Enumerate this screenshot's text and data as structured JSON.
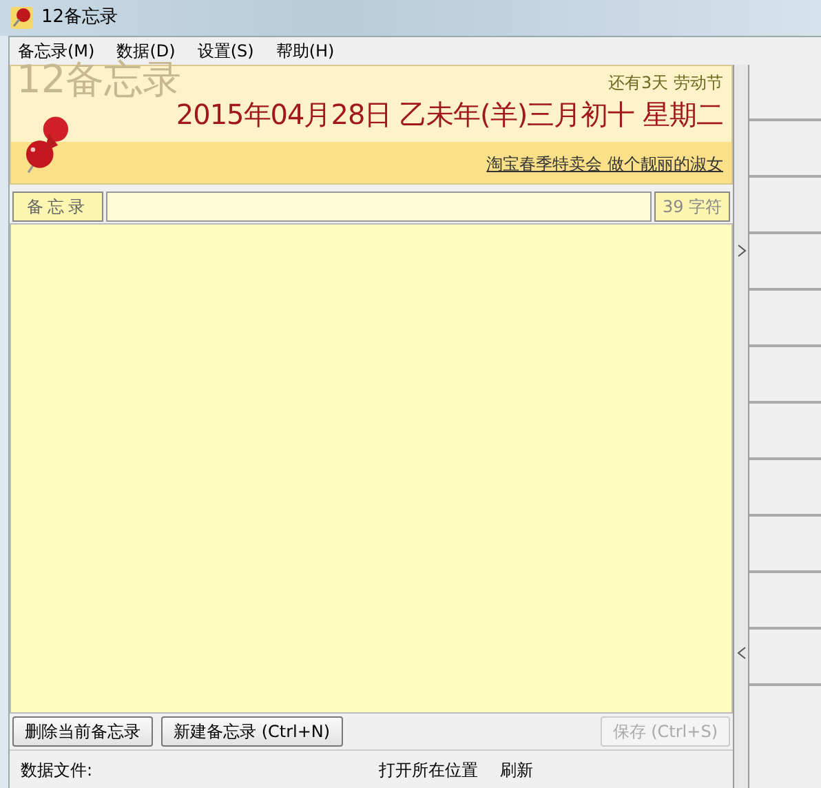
{
  "window": {
    "title": "12备忘录"
  },
  "menu": [
    "备忘录(M)",
    "数据(D)",
    "设置(S)",
    "帮助(H)"
  ],
  "header": {
    "logo_text": "12备忘录",
    "countdown": "还有3天  劳动节",
    "date": "2015年04月28日 乙未年(羊)三月初十 星期二",
    "ad_link": "淘宝春季特卖会  做个靓丽的淑女"
  },
  "editor": {
    "label": "备忘录",
    "char_count": "39 字符"
  },
  "buttons": [
    {
      "label": "删除当前备忘录",
      "disabled": false
    },
    {
      "label": "新建备忘录 (Ctrl+N)",
      "disabled": false
    },
    {
      "label": "保存 (Ctrl+S)",
      "disabled": true
    }
  ],
  "status": {
    "data_file": "数据文件:",
    "open_location": "打开所在位置",
    "refresh": "刷新"
  }
}
